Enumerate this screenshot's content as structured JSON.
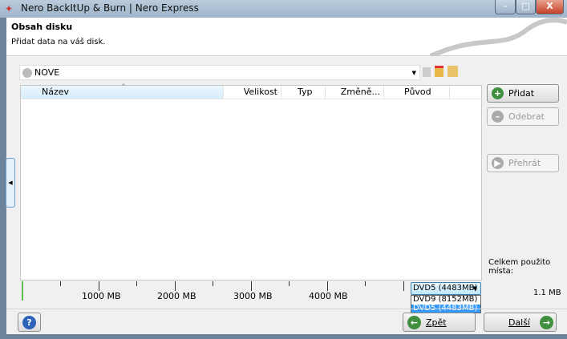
{
  "window": {
    "title": "Nero BackItUp & Burn | Nero Express",
    "minimize": "–",
    "maximize": "□",
    "close": "X"
  },
  "header": {
    "title": "Obsah disku",
    "subtitle": "Přidat data na váš disk."
  },
  "compilation": {
    "name": "NOVE"
  },
  "table": {
    "columns": [
      "Název",
      "Velikost",
      "Typ",
      "Změně...",
      "Původ"
    ],
    "rows": []
  },
  "side_buttons": {
    "add": "Přidat",
    "remove": "Odebrat",
    "play": "Přehrát"
  },
  "usage": {
    "label": "Celkem použito místa:",
    "value": "1.1 MB",
    "fraction": 0.0002
  },
  "ruler": {
    "labels": [
      "1000 MB",
      "2000 MB",
      "3000 MB",
      "4000 MB"
    ]
  },
  "disc_select": {
    "selected": "DVD5 (4483MB)",
    "options": [
      "DVD9 (8152MB)",
      "DVD5 (4483MB)"
    ]
  },
  "footer": {
    "back": "Zpět",
    "next": "Další",
    "help": "?"
  },
  "colors": {
    "accent": "#3399ff",
    "green": "#3f8f3f"
  }
}
